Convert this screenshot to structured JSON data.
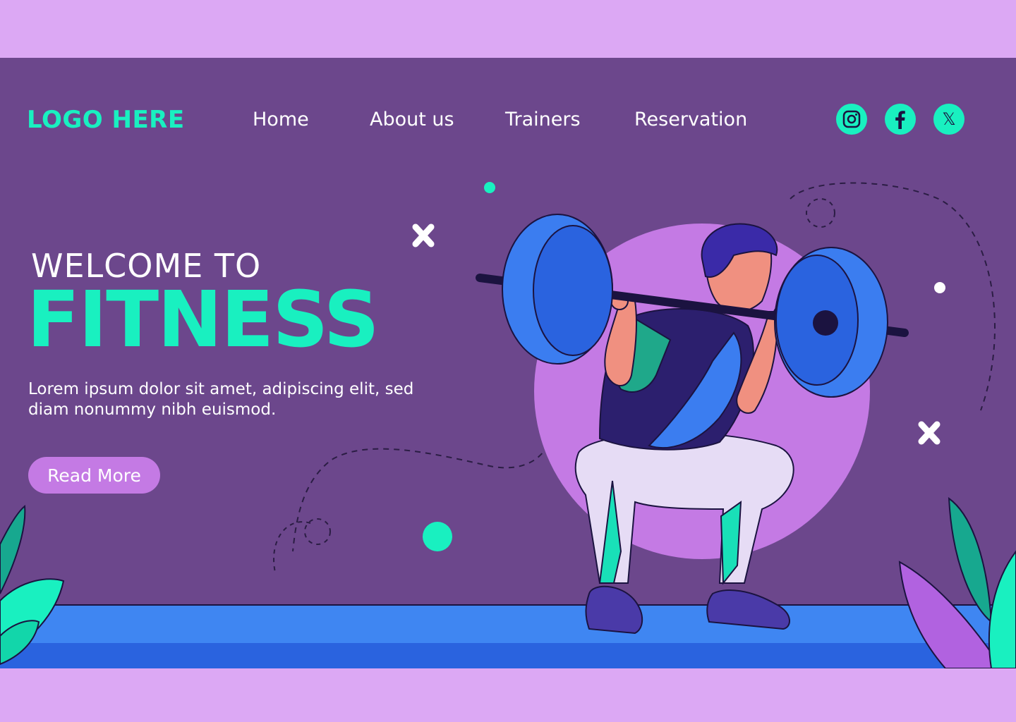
{
  "brand": {
    "logo_text": "LOGO HERE"
  },
  "nav": {
    "items": [
      {
        "label": "Home"
      },
      {
        "label": "About us"
      },
      {
        "label": "Trainers"
      },
      {
        "label": "Reservation"
      }
    ]
  },
  "social": [
    {
      "icon": "instagram-icon"
    },
    {
      "icon": "facebook-icon"
    },
    {
      "icon": "x-twitter-icon",
      "glyph": "𝕏"
    }
  ],
  "hero": {
    "welcome": "WELCOME TO",
    "title": "FITNESS",
    "body": "Lorem ipsum dolor sit amet, adipiscing elit, sed diam nonummy nibh euismod.",
    "cta_label": "Read More"
  },
  "colors": {
    "page_frame": "#dca8f4",
    "background": "#6c478c",
    "accent": "#19f0c0",
    "button": "#c47ae4",
    "floor": "#2f6ee8",
    "weight_plate": "#3b7df0"
  }
}
